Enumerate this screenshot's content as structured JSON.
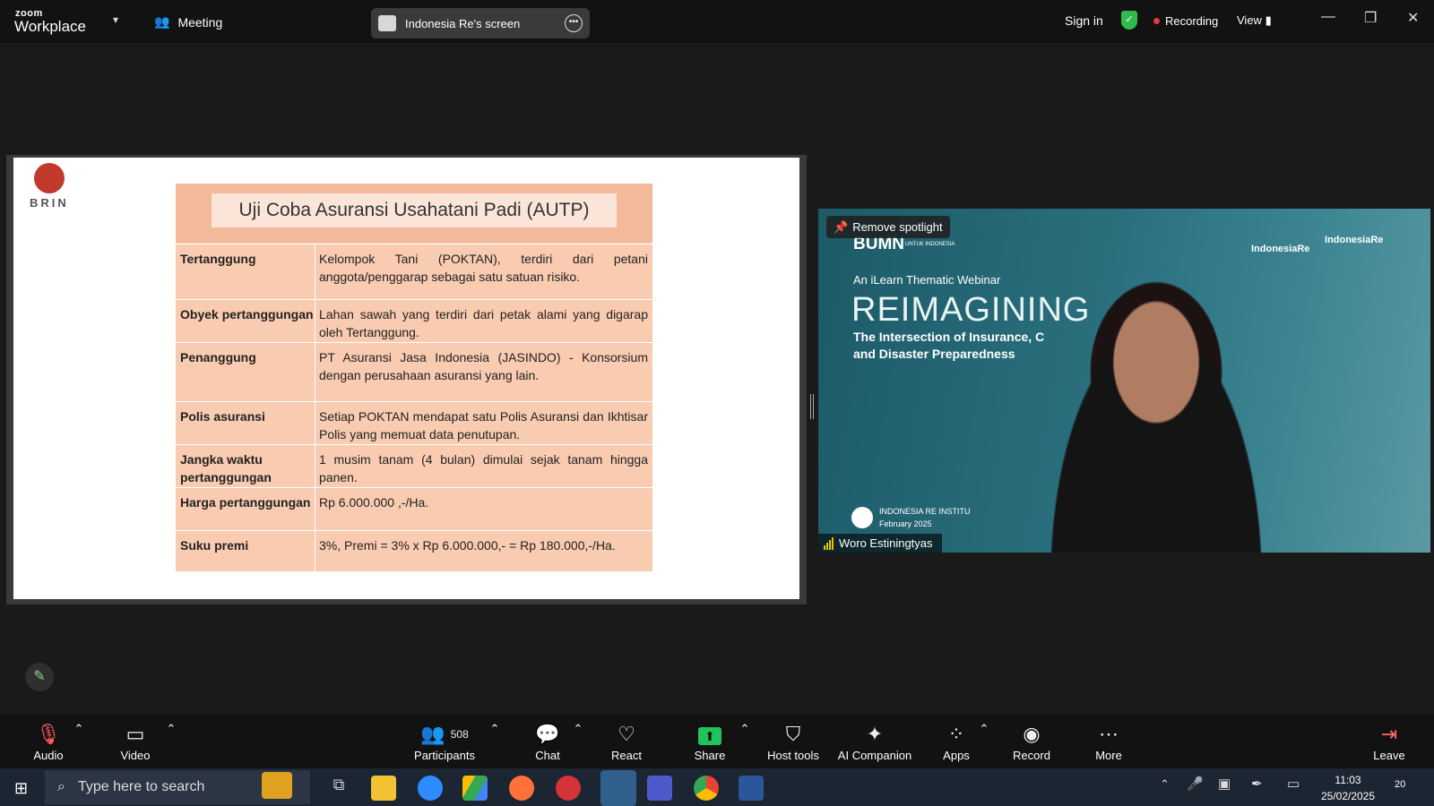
{
  "app": {
    "brand_small": "zoom",
    "brand_large": "Workplace",
    "meeting_label": "Meeting"
  },
  "share": {
    "title": "Indonesia Re's screen"
  },
  "header": {
    "sign_in": "Sign in",
    "recording": "Recording",
    "view": "View"
  },
  "slide": {
    "logo_text": "BRIN",
    "title": "Uji Coba  Asuransi Usahatani Padi (AUTP)",
    "rows": [
      {
        "label": "Tertanggung",
        "value": "Kelompok Tani (POKTAN), terdiri dari petani anggota/penggarap sebagai satu satuan risiko."
      },
      {
        "label": "Obyek pertanggungan",
        "value": "Lahan sawah yang terdiri dari petak alami yang digarap oleh Tertanggung."
      },
      {
        "label": "Penanggung",
        "value": "PT Asuransi Jasa Indonesia (JASINDO) - Konsorsium dengan perusahaan asuransi yang lain."
      },
      {
        "label": "Polis asuransi",
        "value": "Setiap  POKTAN mendapat satu Polis Asuransi dan Ikhtisar Polis yang memuat data penutupan."
      },
      {
        "label": "Jangka waktu pertanggungan",
        "value": "1 musim tanam (4 bulan) dimulai sejak tanam hingga panen."
      },
      {
        "label": "Harga pertanggungan",
        "value": "Rp 6.000.000 ,-/Ha."
      },
      {
        "label": "Suku premi",
        "value": "3%, Premi = 3% x Rp 6.000.000,- = Rp 180.000,-/Ha."
      }
    ]
  },
  "video": {
    "spotlight_button": "Remove spotlight",
    "participant_name": "Woro Estiningtyas",
    "banner_brand": "BUMN",
    "banner_brand_sub": "UNTUK INDONESIA",
    "banner_logo": "IndonesiaRe",
    "banner_logo2": "IndonesiaRe",
    "banner_kicker": "An iLearn Thematic Webinar",
    "banner_title": "REIMAGINING",
    "banner_sub1": "The Intersection of Insurance, C",
    "banner_sub2": "and Disaster Preparedness",
    "banner_org": "INDONESIA RE INSTITU",
    "banner_date": "February 2025"
  },
  "toolbar": {
    "audio": "Audio",
    "video": "Video",
    "participants": "Participants",
    "participants_count": "508",
    "chat": "Chat",
    "react": "React",
    "share": "Share",
    "host_tools": "Host tools",
    "ai_companion": "AI Companion",
    "apps": "Apps",
    "record": "Record",
    "more": "More",
    "leave": "Leave"
  },
  "taskbar": {
    "search_placeholder": "Type here to search",
    "time": "11:03",
    "date": "25/02/2025",
    "notifications": "20"
  },
  "colors": {
    "accent_green": "#2ebd4a",
    "recording_red": "#e83a3a",
    "slide_table": "#f9cbb0",
    "share_green": "#21c35a"
  }
}
